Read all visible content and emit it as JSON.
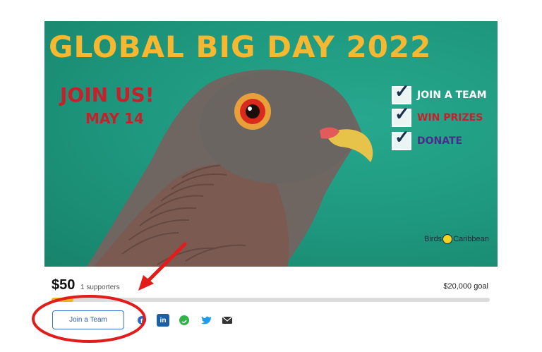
{
  "banner": {
    "title": "GLOBAL BIG DAY 2022",
    "join_us": "JOIN US!",
    "date": "MAY 14",
    "cta_items": [
      {
        "label": "JOIN A TEAM",
        "color": "#ffffff"
      },
      {
        "label": "WIN PRIZES",
        "color": "#c8202b"
      },
      {
        "label": "DONATE",
        "color": "#4a2c8a"
      }
    ],
    "logo_text_left": "Birds",
    "logo_text_right": "Caribbean"
  },
  "fundraiser": {
    "amount": "$50",
    "supporters": "1 supporters",
    "goal": "$20,000 goal",
    "progress_fraction": 0.0025
  },
  "actions": {
    "join_team_label": "Join a Team",
    "share_icons": [
      "facebook-icon",
      "linkedin-icon",
      "whatsapp-icon",
      "twitter-icon",
      "email-icon"
    ]
  },
  "colors": {
    "accent": "#3b6fd1",
    "progress": "#f2b21b",
    "annotation": "#e21b1b",
    "banner_bg": "#1f9a80",
    "title": "#f5b830"
  }
}
